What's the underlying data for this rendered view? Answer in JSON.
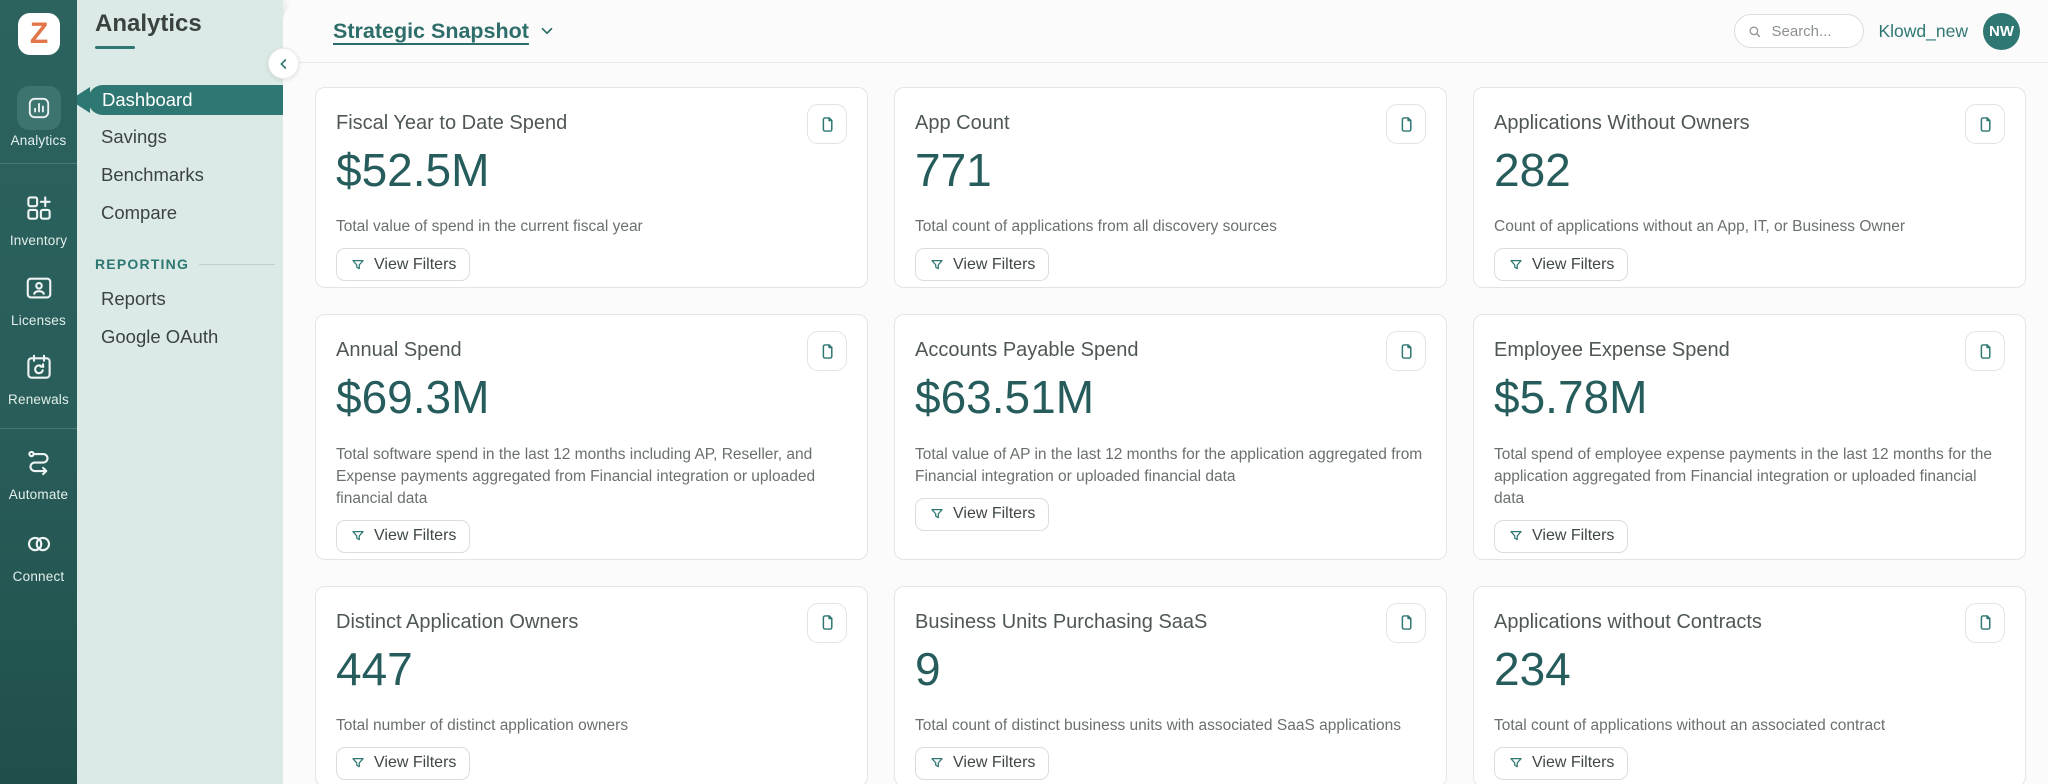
{
  "brand": {
    "logo_letter": "Z"
  },
  "rail": {
    "items": [
      {
        "label": "Analytics",
        "icon": "analytics-icon",
        "active": true
      },
      {
        "label": "Inventory",
        "icon": "inventory-icon",
        "active": false
      },
      {
        "label": "Licenses",
        "icon": "licenses-icon",
        "active": false
      },
      {
        "label": "Renewals",
        "icon": "renewals-icon",
        "active": false
      },
      {
        "label": "Automate",
        "icon": "automate-icon",
        "active": false
      },
      {
        "label": "Connect",
        "icon": "connect-icon",
        "active": false
      }
    ]
  },
  "panel": {
    "title": "Analytics",
    "items": [
      {
        "label": "Dashboard",
        "active": true
      },
      {
        "label": "Savings",
        "active": false
      },
      {
        "label": "Benchmarks",
        "active": false
      },
      {
        "label": "Compare",
        "active": false
      }
    ],
    "section_label": "REPORTING",
    "section_items": [
      {
        "label": "Reports"
      },
      {
        "label": "Google OAuth"
      }
    ]
  },
  "header": {
    "dashboard_title": "Strategic Snapshot",
    "search_placeholder": "Search...",
    "workspace_name": "Klowd_new",
    "avatar_initials": "NW"
  },
  "cards_common": {
    "filter_button_label": "View Filters"
  },
  "cards": [
    {
      "title": "Fiscal Year to Date Spend",
      "value": "$52.5M",
      "description": "Total value of spend in the current fiscal year"
    },
    {
      "title": "App Count",
      "value": "771",
      "description": "Total count of applications from all discovery sources"
    },
    {
      "title": "Applications Without Owners",
      "value": "282",
      "description": "Count of applications without an App, IT, or Business Owner"
    },
    {
      "title": "Annual Spend",
      "value": "$69.3M",
      "description": "Total software spend in the last 12 months including AP, Reseller, and Expense payments aggregated from Financial integration or uploaded financial data"
    },
    {
      "title": "Accounts Payable Spend",
      "value": "$63.51M",
      "description": "Total value of AP in the last 12 months for the application aggregated from Financial integration or uploaded financial data"
    },
    {
      "title": "Employee Expense Spend",
      "value": "$5.78M",
      "description": "Total spend of employee expense payments in the last 12 months for the application aggregated from Financial integration or uploaded financial data"
    },
    {
      "title": "Distinct Application Owners",
      "value": "447",
      "description": "Total number of distinct application owners"
    },
    {
      "title": "Business Units Purchasing SaaS",
      "value": "9",
      "description": "Total count of distinct business units with associated SaaS applications"
    },
    {
      "title": "Applications without Contracts",
      "value": "234",
      "description": "Total count of applications without an associated contract"
    }
  ],
  "colors": {
    "accent_teal": "#2E7772",
    "rail_background": "#2C635F",
    "panel_background": "#DBE9E7",
    "value_text": "#265C5B",
    "logo_orange": "#E0764A"
  }
}
